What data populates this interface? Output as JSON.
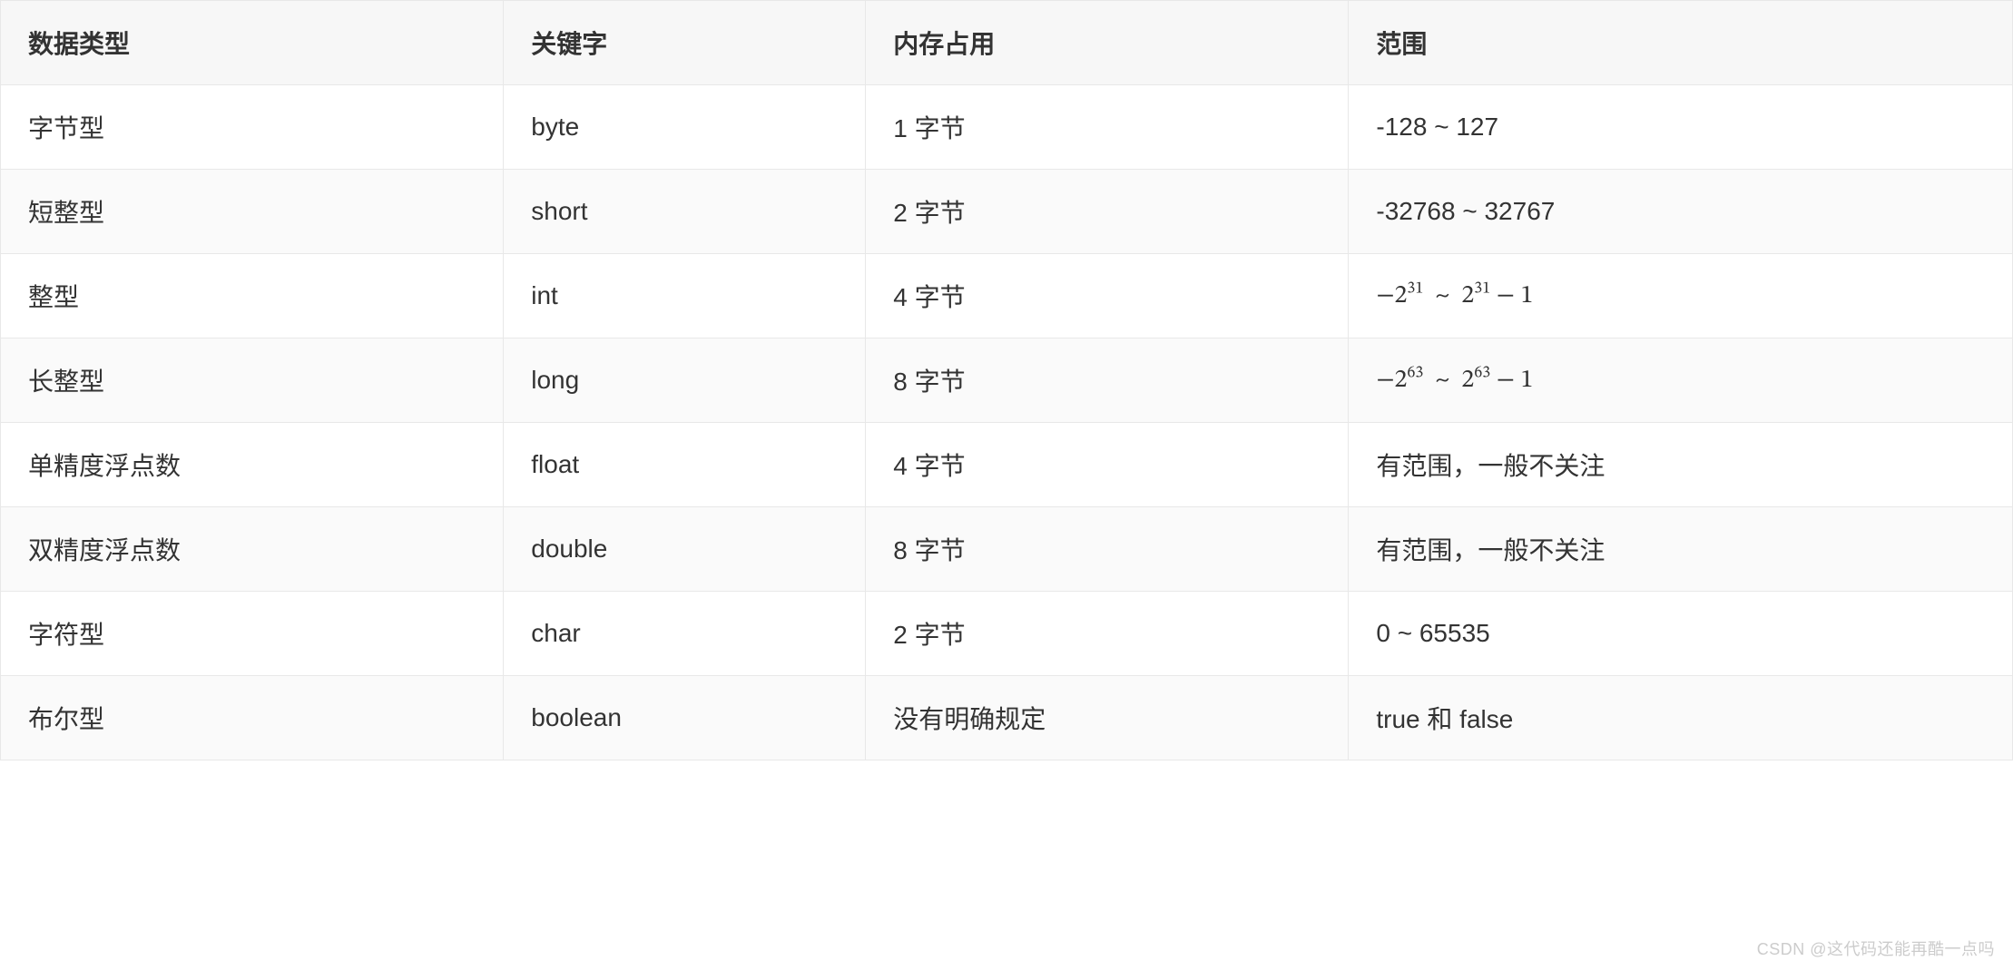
{
  "table": {
    "headers": [
      "数据类型",
      "关键字",
      "内存占用",
      "范围"
    ],
    "rows": [
      {
        "type": "字节型",
        "keyword": "byte",
        "memory": "1 字节",
        "range_text": "-128 ~ 127",
        "range_kind": "text"
      },
      {
        "type": "短整型",
        "keyword": "short",
        "memory": "2 字节",
        "range_text": "-32768 ~ 32767",
        "range_kind": "text"
      },
      {
        "type": "整型",
        "keyword": "int",
        "memory": "4 字节",
        "range_kind": "pow",
        "range_exp": "31"
      },
      {
        "type": "长整型",
        "keyword": "long",
        "memory": "8 字节",
        "range_kind": "pow",
        "range_exp": "63"
      },
      {
        "type": "单精度浮点数",
        "keyword": "float",
        "memory": "4 字节",
        "range_text": "有范围，一般不关注",
        "range_kind": "text"
      },
      {
        "type": "双精度浮点数",
        "keyword": "double",
        "memory": "8 字节",
        "range_text": "有范围，一般不关注",
        "range_kind": "text"
      },
      {
        "type": "字符型",
        "keyword": "char",
        "memory": "2 字节",
        "range_text": "0 ~ 65535",
        "range_kind": "text"
      },
      {
        "type": "布尔型",
        "keyword": "boolean",
        "memory": "没有明确规定",
        "range_text": "true 和 false",
        "range_kind": "text"
      }
    ]
  },
  "watermark": "CSDN @这代码还能再酷一点吗"
}
